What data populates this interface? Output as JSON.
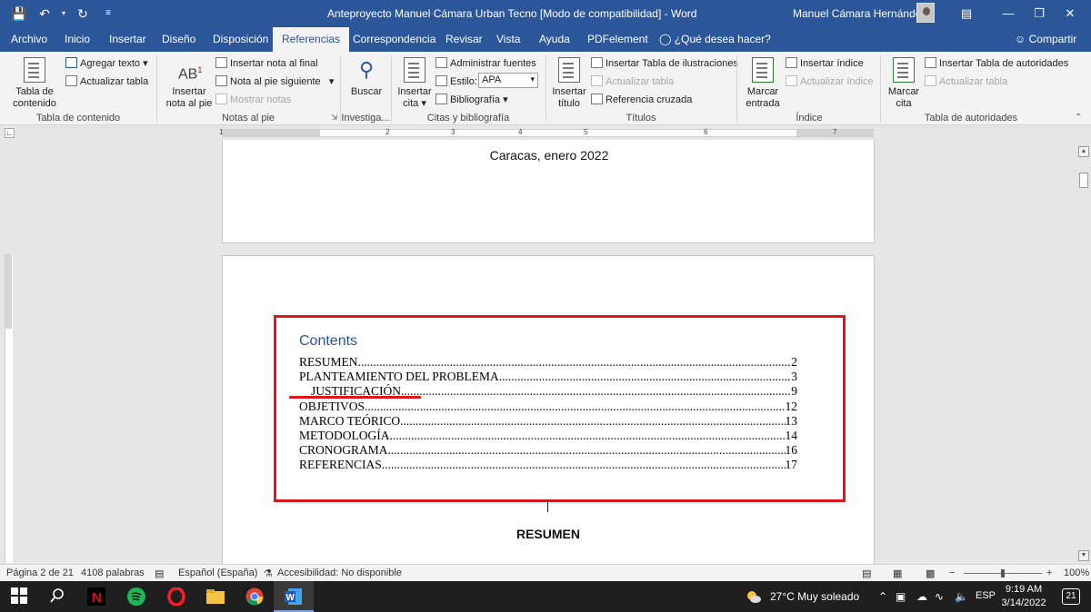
{
  "titlebar": {
    "title": "Anteproyecto Manuel Cámara  Urban Tecno [Modo de compatibilidad]  -  Word",
    "user": "Manuel Cámara Hernández"
  },
  "tabs": [
    "Archivo",
    "Inicio",
    "Insertar",
    "Diseño",
    "Disposición",
    "Referencias",
    "Correspondencia",
    "Revisar",
    "Vista",
    "Ayuda",
    "PDFelement"
  ],
  "active_tab": "Referencias",
  "tell_me": "¿Qué desea hacer?",
  "share": "Compartir",
  "ribbon": {
    "toc": {
      "big1": "Tabla de",
      "big2": "contenido",
      "add_text": "Agregar texto",
      "update": "Actualizar tabla",
      "group": "Tabla de contenido"
    },
    "footnotes": {
      "big1": "Insertar",
      "big2": "nota al pie",
      "endnote": "Insertar nota al final",
      "next": "Nota al pie siguiente",
      "show": "Mostrar notas",
      "group": "Notas al pie"
    },
    "research": {
      "big": "Buscar",
      "group": "Investiga..."
    },
    "citations": {
      "big1": "Insertar",
      "big2": "cita",
      "manage": "Administrar fuentes",
      "style_label": "Estilo:",
      "style_value": "APA",
      "biblio": "Bibliografía",
      "group": "Citas y bibliografía"
    },
    "captions": {
      "big1": "Insertar",
      "big2": "título",
      "ins_figs": "Insertar Tabla de ilustraciones",
      "update": "Actualizar tabla",
      "cross": "Referencia cruzada",
      "group": "Títulos"
    },
    "index": {
      "big1": "Marcar",
      "big2": "entrada",
      "insert": "Insertar índice",
      "update": "Actualizar índice",
      "group": "Índice"
    },
    "authorities": {
      "big1": "Marcar",
      "big2": "cita",
      "insert": "Insertar Tabla de autoridades",
      "update": "Actualizar tabla",
      "group": "Tabla de autoridades"
    }
  },
  "ruler_numbers": [
    "1",
    "2",
    "3",
    "4",
    "5",
    "6",
    "7"
  ],
  "document": {
    "page1_text": "Caracas, enero 2022",
    "toc_title": "Contents",
    "toc": [
      {
        "label": "RESUMEN",
        "page": "2",
        "indent": false
      },
      {
        "label": "PLANTEAMIENTO DEL PROBLEMA",
        "page": "3",
        "indent": false
      },
      {
        "label": "JUSTIFICACIÓN",
        "page": "9",
        "indent": true
      },
      {
        "label": "OBJETIVOS",
        "page": "12",
        "indent": false
      },
      {
        "label": "MARCO TEÓRICO",
        "page": "13",
        "indent": false
      },
      {
        "label": "METODOLOGÍA",
        "page": "14",
        "indent": false
      },
      {
        "label": "CRONOGRAMA",
        "page": "16",
        "indent": false
      },
      {
        "label": "REFERENCIAS",
        "page": "17",
        "indent": false
      }
    ],
    "heading": "RESUMEN"
  },
  "status": {
    "page": "Página 2 de 21",
    "words": "4108 palabras",
    "lang": "Español (España)",
    "access": "Accesibilidad: No disponible",
    "zoom": "100%",
    "zoom_minus": "−",
    "zoom_plus": "+"
  },
  "taskbar": {
    "weather": "27°C  Muy soleado",
    "lang": "ESP",
    "time": "9:19 AM",
    "date": "3/14/2022",
    "notifications": "21"
  },
  "colors": {
    "accent": "#2b579a",
    "highlight": "#e4141b",
    "toc_title": "#2f5496"
  }
}
